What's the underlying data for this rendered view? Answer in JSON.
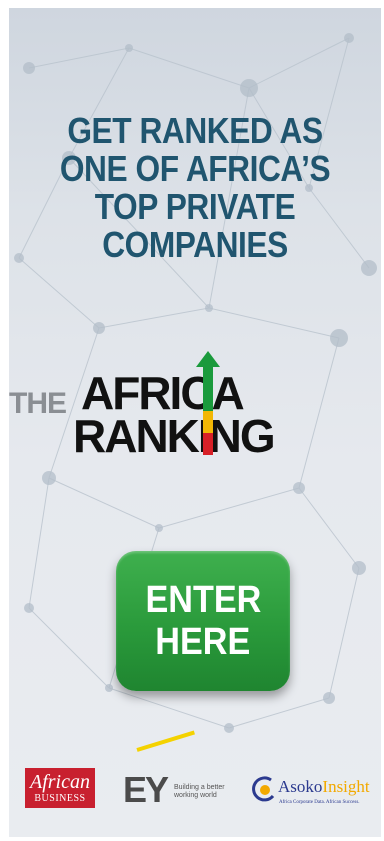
{
  "headline": {
    "lines": [
      "GET RANKED AS",
      "ONE OF AFRICA’S",
      "TOP PRIVATE",
      "COMPANIES"
    ]
  },
  "logo": {
    "prefix": "THE",
    "line1": "AFRICA",
    "line2": "RANKING"
  },
  "cta": {
    "line1": "ENTER",
    "line2": "HERE"
  },
  "partners": {
    "african_business": {
      "line1": "African",
      "line2": "BUSINESS"
    },
    "ey": {
      "mark": "EY",
      "tagline": "Building a better working world"
    },
    "asoko": {
      "word1": "Asoko",
      "word2": "Insight",
      "tagline": "Africa Corporate Data. African Success."
    }
  },
  "colors": {
    "headline": "#20556f",
    "button_green": "#2a9a3b",
    "african_business_red": "#c8202f",
    "ey_yellow": "#f4d200",
    "asoko_blue": "#2b3a8f",
    "asoko_gold": "#f2a900"
  }
}
